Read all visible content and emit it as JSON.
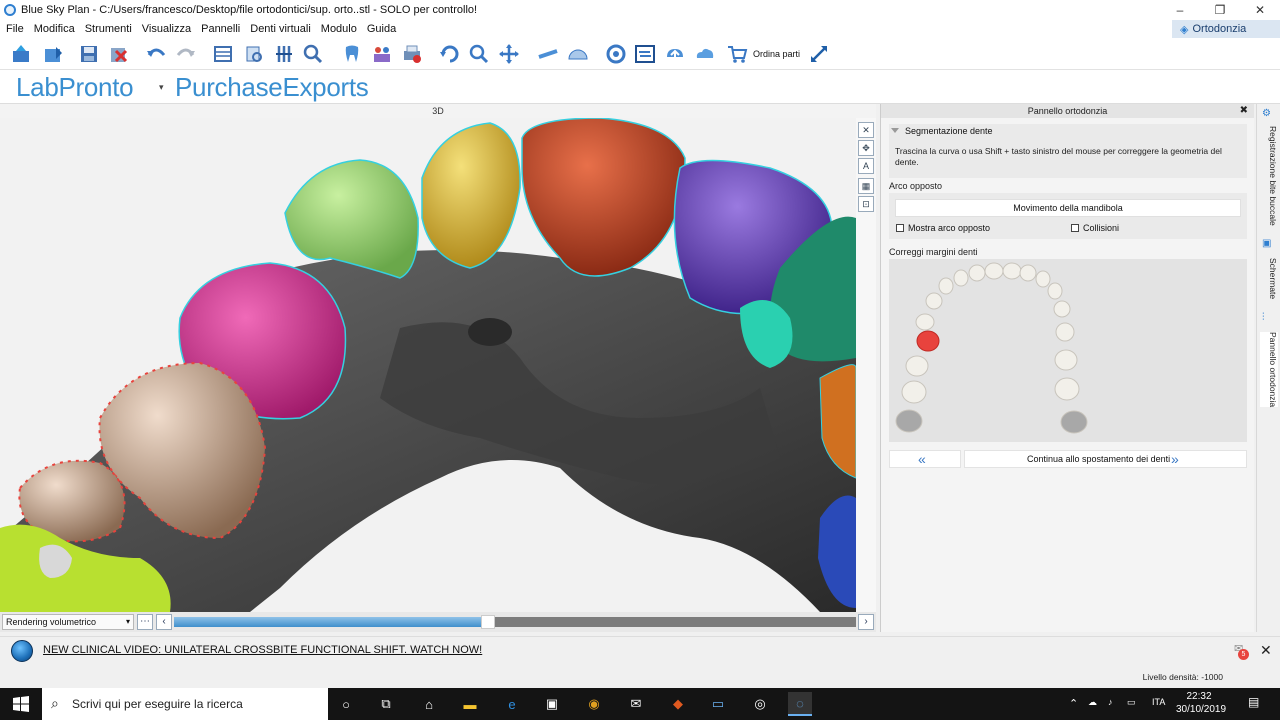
{
  "window": {
    "title": "Blue Sky Plan - C:/Users/francesco/Desktop/file ortodontici/sup. orto..stl - SOLO per controllo!",
    "minimize_glyph": "–",
    "maximize_glyph": "❐",
    "close_glyph": "✕"
  },
  "menu": {
    "items": [
      "File",
      "Modifica",
      "Strumenti",
      "Visualizza",
      "Pannelli",
      "Denti virtuali",
      "Modulo",
      "Guida"
    ],
    "mode_label": "Ortodonzia"
  },
  "toolbar": {
    "ordina_label": "Ordina parti",
    "icons": [
      "open-icon",
      "import-icon",
      "save-icon",
      "close-file-icon",
      "undo-icon",
      "redo-icon",
      "layout-icon",
      "scan-icon",
      "cross-section-icon",
      "zoom-icon",
      "tooth-icon",
      "family-icon",
      "print-icon",
      "rotate-icon",
      "zoom-in-icon",
      "pan-icon",
      "ruler-icon",
      "protractor-icon",
      "circle-icon",
      "compare-icon",
      "upload-icon",
      "cloud-icon",
      "cart-icon",
      "expand-icon"
    ]
  },
  "brand": {
    "labpronto": "LabPronto",
    "purchase": "PurchaseExports"
  },
  "viewport": {
    "label": "3D",
    "tools": [
      "✕",
      "✥",
      "A",
      "▦",
      "⊡"
    ]
  },
  "render": {
    "mode": "Rendering volumetrico",
    "slider_value": 0.45
  },
  "panel": {
    "title": "Pannello ortodonzia",
    "close": "✖",
    "segmentation_title": "Segmentazione dente",
    "segmentation_desc": "Trascina la curva o usa Shift + tasto sinistro del mouse per correggere la geometria del dente.",
    "arco_opposto_label": "Arco opposto",
    "mandibola_button": "Movimento della mandibola",
    "mostra_arco": "Mostra arco opposto",
    "collisioni": "Collisioni",
    "correggi_label": "Correggi margini denti",
    "continue_button": "Continua allo spostamento dei denti"
  },
  "right_tabs": [
    "Registrazione bite buccale",
    "Schermate",
    "Pannello ortodonzia"
  ],
  "news": {
    "text": "NEW CLINICAL VIDEO: UNILATERAL CROSSBITE FUNCTIONAL SHIFT. WATCH NOW!",
    "badge": "5"
  },
  "status": {
    "density": "Livello densità: -1000"
  },
  "taskbar": {
    "search_placeholder": "Scrivi qui per eseguire la ricerca",
    "language": "ITA",
    "time": "22:32",
    "date": "30/10/2019"
  },
  "colors": {
    "accent_blue": "#2f7fd0",
    "selected_tooth": "#e8433d",
    "tooth_green": "#8fd06a",
    "tooth_yellow": "#e3c33a",
    "tooth_orange": "#c8482a",
    "tooth_purple": "#6a44b8",
    "tooth_magenta": "#d02a8f",
    "tooth_beige": "#c9a58a",
    "outline_cyan": "#35d0e0"
  }
}
